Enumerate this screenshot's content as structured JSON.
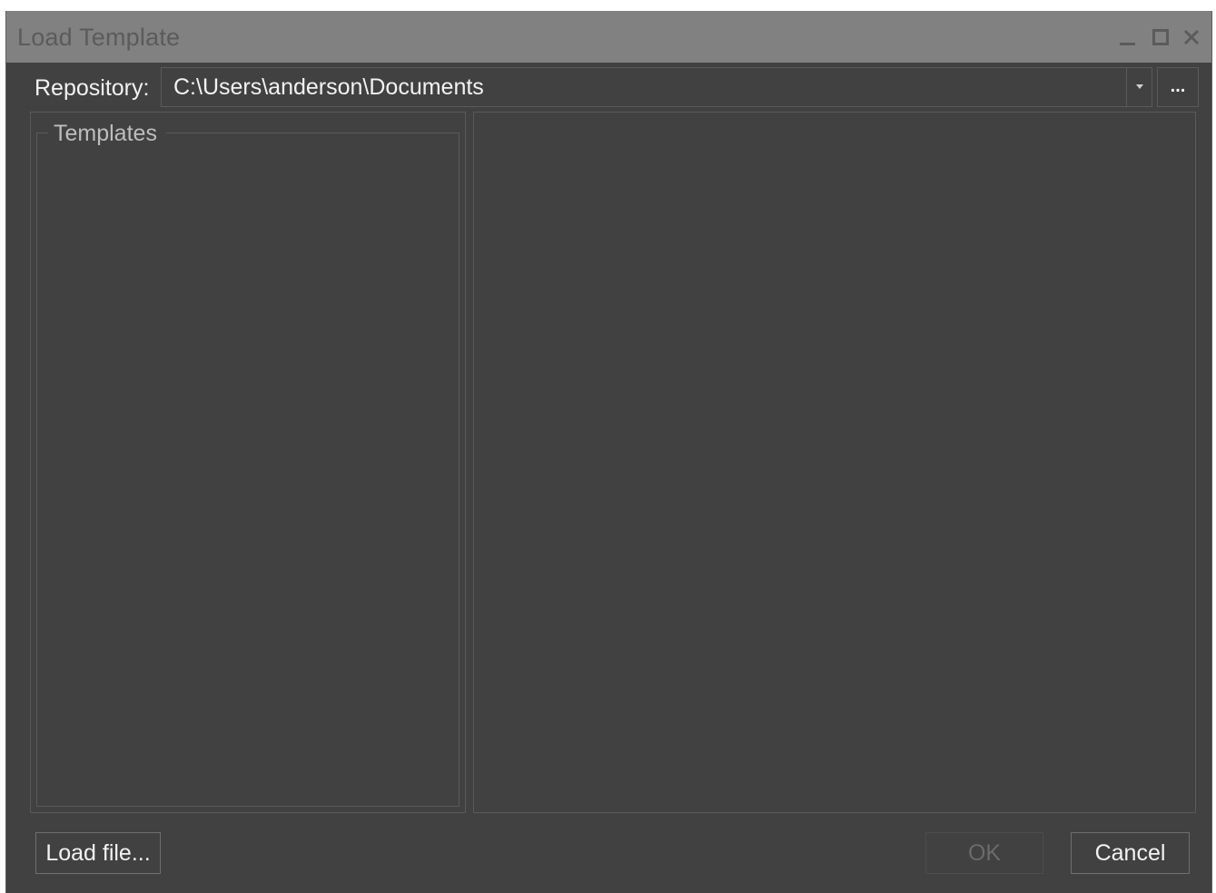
{
  "window": {
    "title": "Load Template"
  },
  "repository": {
    "label": "Repository:",
    "value": "C:\\Users\\anderson\\Documents",
    "browse_label": "..."
  },
  "templates": {
    "group_title": "Templates",
    "items": []
  },
  "buttons": {
    "load_file": "Load file...",
    "ok": "OK",
    "ok_enabled": false,
    "cancel": "Cancel"
  },
  "colors": {
    "titlebar": "#818181",
    "background": "#414141",
    "text": "#f2f2f2",
    "border": "#5a5a5a",
    "disabled_text": "#6b6b6b"
  },
  "icons": {
    "minimize": "minimize-icon",
    "maximize": "maximize-icon",
    "close": "close-icon",
    "dropdown": "chevron-down-icon"
  }
}
